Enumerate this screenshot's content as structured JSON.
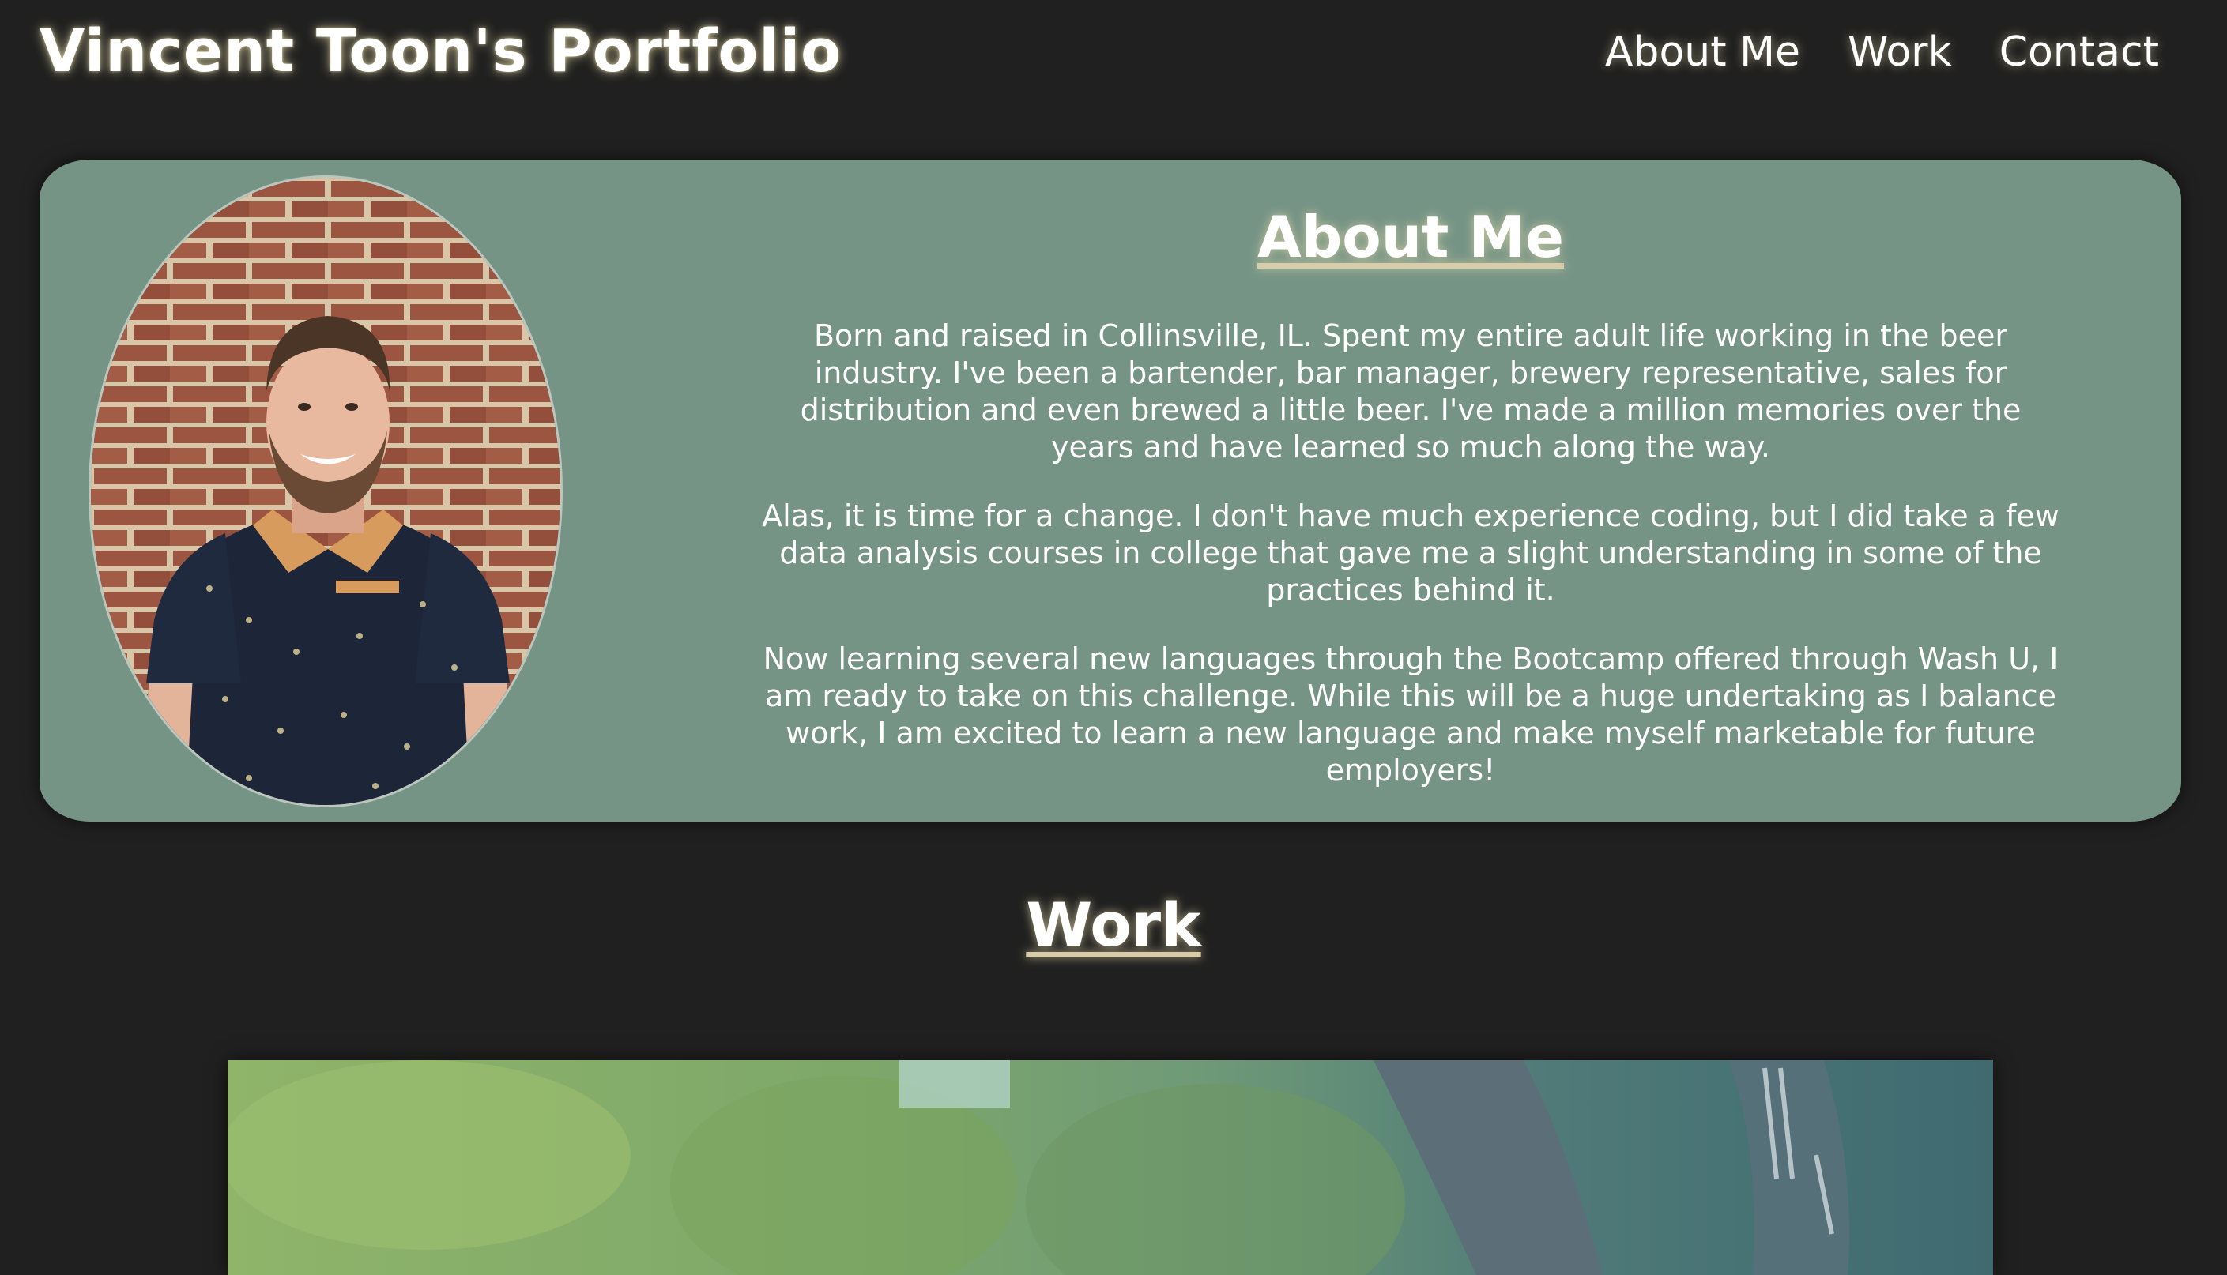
{
  "header": {
    "title": "Vincent Toon's Portfolio",
    "nav": [
      {
        "label": "About Me"
      },
      {
        "label": "Work"
      },
      {
        "label": "Contact"
      }
    ]
  },
  "about": {
    "heading": "About Me",
    "paragraphs": [
      "Born and raised in Collinsville, IL. Spent my entire adult life working in the beer industry. I've been a bartender, bar manager, brewery representative, sales for distribution and even brewed a little beer. I've made a million memories over the years and have learned so much along the way.",
      "Alas, it is time for a change. I don't have much experience coding, but I did take a few data analysis courses in college that gave me a slight understanding in some of the practices behind it.",
      "Now learning several new languages through the Bootcamp offered through Wash U, I am ready to take on this challenge. While this will be a huge undertaking as I balance work, I am excited to learn a new language and make myself marketable for future employers!"
    ]
  },
  "work": {
    "heading": "Work"
  },
  "colors": {
    "background": "#202020",
    "card": "#769486",
    "text": "#ffffff",
    "glow": "#e8dcaa"
  }
}
